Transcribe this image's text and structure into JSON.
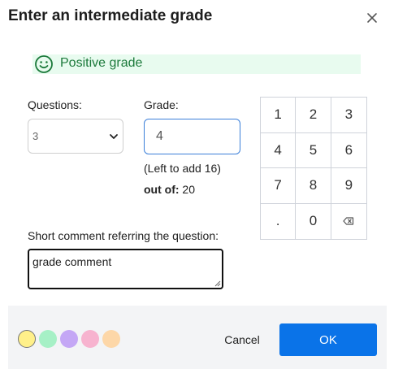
{
  "dialog": {
    "title": "Enter an intermediate grade",
    "close_icon": "close-icon"
  },
  "grade_status": {
    "icon": "smiley-icon",
    "text": "Positive grade",
    "color": "#1c7a3b",
    "background": "#e8fbef"
  },
  "questions": {
    "label": "Questions:",
    "selected": "3"
  },
  "grade": {
    "label": "Grade:",
    "value": "4",
    "left_to_add": "(Left to add 16)",
    "out_of_label": "out of:",
    "out_of_value": "20"
  },
  "keypad": {
    "keys": [
      "1",
      "2",
      "3",
      "4",
      "5",
      "6",
      "7",
      "8",
      "9",
      ".",
      "0"
    ],
    "backspace_icon": "backspace-icon"
  },
  "comment": {
    "label": "Short comment referring the question:",
    "value": "grade comment"
  },
  "footer": {
    "swatches": [
      {
        "name": "yellow",
        "color": "#fff08a"
      },
      {
        "name": "green",
        "color": "#a6f0c6"
      },
      {
        "name": "purple",
        "color": "#c4a7f5"
      },
      {
        "name": "pink",
        "color": "#f7b3cf"
      },
      {
        "name": "orange",
        "color": "#fdd7a8"
      }
    ],
    "cancel_label": "Cancel",
    "ok_label": "OK",
    "ok_color": "#0a73e8"
  }
}
